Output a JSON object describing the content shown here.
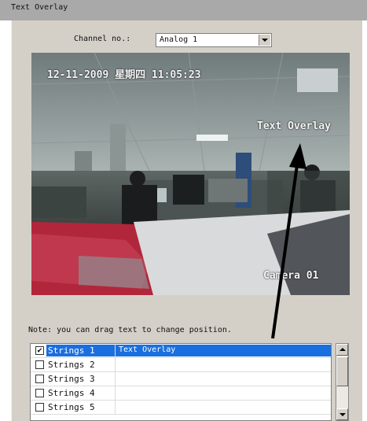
{
  "window": {
    "title": "Text Overlay"
  },
  "channel": {
    "label": "Channel no.:",
    "value": "Analog 1"
  },
  "video": {
    "datetime": "12-11-2009 星期四 11:05:23",
    "text_overlay": "Text Overlay",
    "camera_name": "Camera 01"
  },
  "note": "Note: you can drag text to change position.",
  "strings": [
    {
      "name": "Strings 1",
      "text": "Text Overlay",
      "checked": true
    },
    {
      "name": "Strings 2",
      "text": "",
      "checked": false
    },
    {
      "name": "Strings 3",
      "text": "",
      "checked": false
    },
    {
      "name": "Strings 4",
      "text": "",
      "checked": false
    },
    {
      "name": "Strings 5",
      "text": "",
      "checked": false
    }
  ],
  "colors": {
    "selection": "#1a6fe0",
    "titlebar": "#a9a9a9",
    "panel": "#d4d0c8"
  }
}
